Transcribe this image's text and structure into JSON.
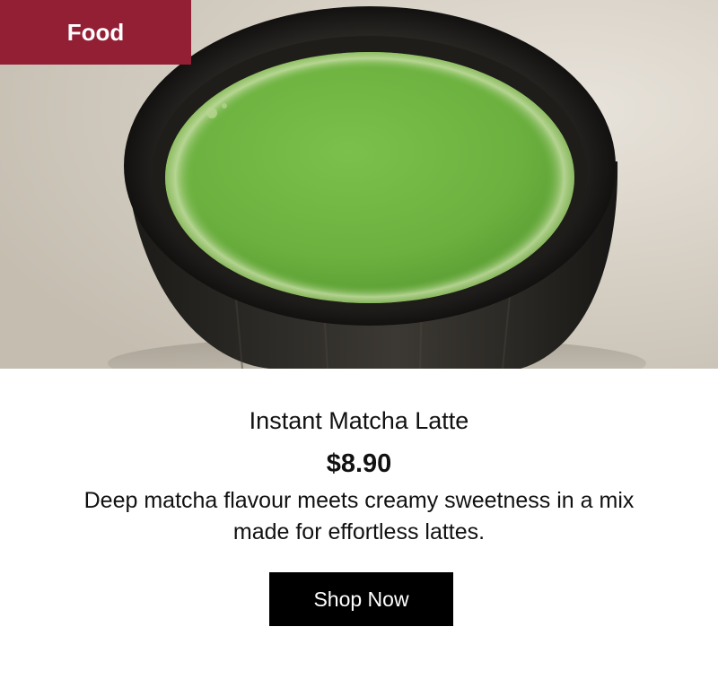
{
  "badge": {
    "label": "Food"
  },
  "hero": {
    "image_subject": "bowl of matcha latte"
  },
  "product": {
    "title": "Instant Matcha Latte",
    "price": "$8.90",
    "description": "Deep matcha flavour meets creamy sweetness in a mix made for effortless lattes."
  },
  "cta": {
    "label": "Shop Now"
  },
  "colors": {
    "badge_bg": "#931f35",
    "cta_bg": "#000000",
    "matcha": "#6fb443"
  }
}
